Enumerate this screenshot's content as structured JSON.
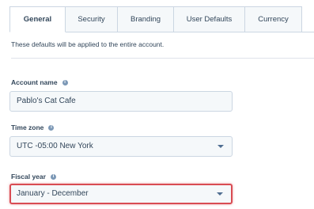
{
  "tabs": [
    {
      "label": "General",
      "active": true
    },
    {
      "label": "Security"
    },
    {
      "label": "Branding"
    },
    {
      "label": "User Defaults"
    },
    {
      "label": "Currency"
    }
  ],
  "description": "These defaults will be applied to the entire account.",
  "account_name": {
    "label": "Account name",
    "value": "Pablo's Cat Cafe"
  },
  "time_zone": {
    "label": "Time zone",
    "value": "UTC -05:00 New York"
  },
  "fiscal_year": {
    "label": "Fiscal year",
    "value": "January - December"
  },
  "icons": {
    "info": "info-icon",
    "dropdown": "chevron-down-icon"
  },
  "colors": {
    "focus_border": "#d94c53",
    "text": "#33475b",
    "field_bg": "#f5f8fa"
  }
}
